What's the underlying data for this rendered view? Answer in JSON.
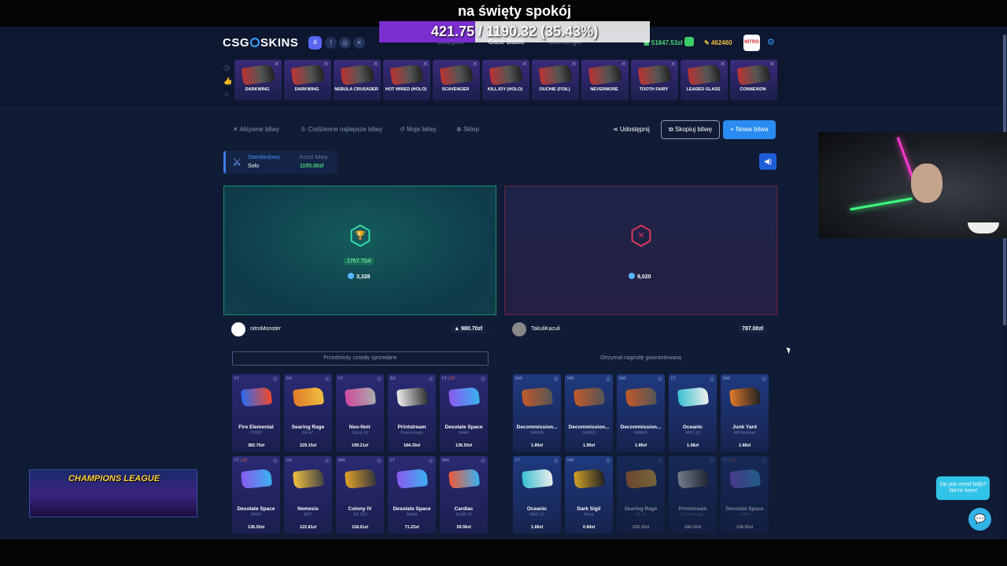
{
  "overlay": {
    "top_text": "na święty spokój",
    "progress_text": "421.75 / 1190.32 (35.43%)",
    "progress_pct": 35.43
  },
  "header": {
    "logo": "CSG",
    "logo_rest": "SKINS",
    "nav": [
      "Skrzynki",
      "Case Battle",
      "Exchanger"
    ],
    "balance": "51847.53zł",
    "coins": "462460",
    "avatar_text": "NITRO"
  },
  "drops": [
    "DARKWING",
    "DARKWING",
    "NEBULA CRUSADER",
    "HOT WIRED (HOLO)",
    "SCAVENGER",
    "KILLJOY (HOLO)",
    "OUCHIE (FOIL)",
    "NEVERMORE",
    "TOOTH FAIRY",
    "LEADED GLASS",
    "CONNEXION"
  ],
  "tabs": {
    "active": "Aktywne bitwy",
    "daily": "Codzienne najlepsze bitwy",
    "mine": "Moje bitwy",
    "shop": "Sklep",
    "share": "Udostępnij",
    "copy": "Skopiuj bitwę",
    "new": "+ Nowa bitwa"
  },
  "mode": {
    "type": "Standardowy",
    "sub": "Solo",
    "cost_label": "Koszt bitwy",
    "cost": "1155.00zł"
  },
  "left": {
    "prize": "1767.70zł",
    "gems": "3,328",
    "player": "nitroMonster",
    "value": "▲ 980.70zł",
    "status": "Przedmioty zostały sprzedane",
    "items": [
      {
        "cond": "FT",
        "st": "",
        "name": "Fire Elemental",
        "sub": "P2000",
        "price": "382.70zł",
        "c1": "#2a6af0",
        "c2": "#f04a2a"
      },
      {
        "cond": "FN",
        "st": "",
        "name": "Searing Rage",
        "sub": "AK-47",
        "price": "229.15zł",
        "c1": "#e07a2a",
        "c2": "#f0c040"
      },
      {
        "cond": "FT",
        "st": "",
        "name": "Neo-Noir",
        "sub": "Glock-18",
        "price": "199.21zł",
        "c1": "#d04aa0",
        "c2": "#aaa"
      },
      {
        "cond": "BS",
        "st": "",
        "name": "Printstream",
        "sub": "Desert Eagle",
        "price": "184.30zł",
        "c1": "#eeeeee",
        "c2": "#333"
      },
      {
        "cond": "FT |",
        "st": "ST",
        "name": "Desolate Space",
        "sub": "M4A4",
        "price": "136.50zł",
        "c1": "#8a5af0",
        "c2": "#3ab0f0"
      },
      {
        "cond": "FT |",
        "st": "ST",
        "name": "Desolate Space",
        "sub": "M4A4",
        "price": "136.50zł",
        "c1": "#8a5af0",
        "c2": "#3ab0f0"
      },
      {
        "cond": "FN",
        "st": "",
        "name": "Nemesis",
        "sub": "MP7",
        "price": "122.81zł",
        "c1": "#f0c040",
        "c2": "#444"
      },
      {
        "cond": "MW",
        "st": "",
        "name": "Colony IV",
        "sub": "SG 553",
        "price": "118.61zł",
        "c1": "#e0a02a",
        "c2": "#3a3a3a"
      },
      {
        "cond": "FT",
        "st": "",
        "name": "Desolate Space",
        "sub": "M4A4",
        "price": "71.23zł",
        "c1": "#8a5af0",
        "c2": "#3ab0f0"
      },
      {
        "cond": "MW",
        "st": "",
        "name": "Cardiac",
        "sub": "SCAR-20",
        "price": "59.56zł",
        "c1": "#f05a3a",
        "c2": "#3ab0f0"
      }
    ]
  },
  "right": {
    "gems": "9,020",
    "player": "TakuliKaculi",
    "value": "787.00zł",
    "status": "Otrzymał nagrodę gwarantowaną",
    "items": [
      {
        "cond": "MW",
        "st": "",
        "name": "Decommission...",
        "sub": "FAMAS",
        "price": "1.89zł",
        "c1": "#c05a2a",
        "c2": "#555"
      },
      {
        "cond": "MW",
        "st": "",
        "name": "Decommission...",
        "sub": "FAMAS",
        "price": "1.89zł",
        "c1": "#c05a2a",
        "c2": "#555"
      },
      {
        "cond": "MW",
        "st": "",
        "name": "Decommission...",
        "sub": "FAMAS",
        "price": "1.89zł",
        "c1": "#c05a2a",
        "c2": "#555"
      },
      {
        "cond": "FT",
        "st": "",
        "name": "Oceanic",
        "sub": "MAC-10",
        "price": "1.68zł",
        "c1": "#3ac0d0",
        "c2": "#eee"
      },
      {
        "cond": "MW",
        "st": "",
        "name": "Junk Yard",
        "sub": "R8 Revolver",
        "price": "1.68zł",
        "c1": "#e07a2a",
        "c2": "#222"
      },
      {
        "cond": "FT",
        "st": "",
        "name": "Oceanic",
        "sub": "MAC-10",
        "price": "1.68zł",
        "c1": "#3ac0d0",
        "c2": "#eee"
      },
      {
        "cond": "MW",
        "st": "",
        "name": "Dark Sigil",
        "sub": "Nova",
        "price": "0.84zł",
        "c1": "#d0a02a",
        "c2": "#222"
      },
      {
        "cond": "",
        "st": "",
        "name": "Searing Rage",
        "sub": "AK-47",
        "price": "229.15zł",
        "c1": "#e07a2a",
        "c2": "#f0c040"
      },
      {
        "cond": "",
        "st": "",
        "name": "Printstream",
        "sub": "Desert Eagle",
        "price": "184.30zł",
        "c1": "#eeeeee",
        "c2": "#333"
      },
      {
        "cond": "FT |",
        "st": "ST",
        "name": "Desolate Space",
        "sub": "M4A4",
        "price": "136.50zł",
        "c1": "#8a5af0",
        "c2": "#3ab0f0"
      }
    ]
  },
  "promo": {
    "title": "CHAMPIONS LEAGUE"
  },
  "help": {
    "line1": "Do you need help?",
    "line2": "We're here!"
  }
}
